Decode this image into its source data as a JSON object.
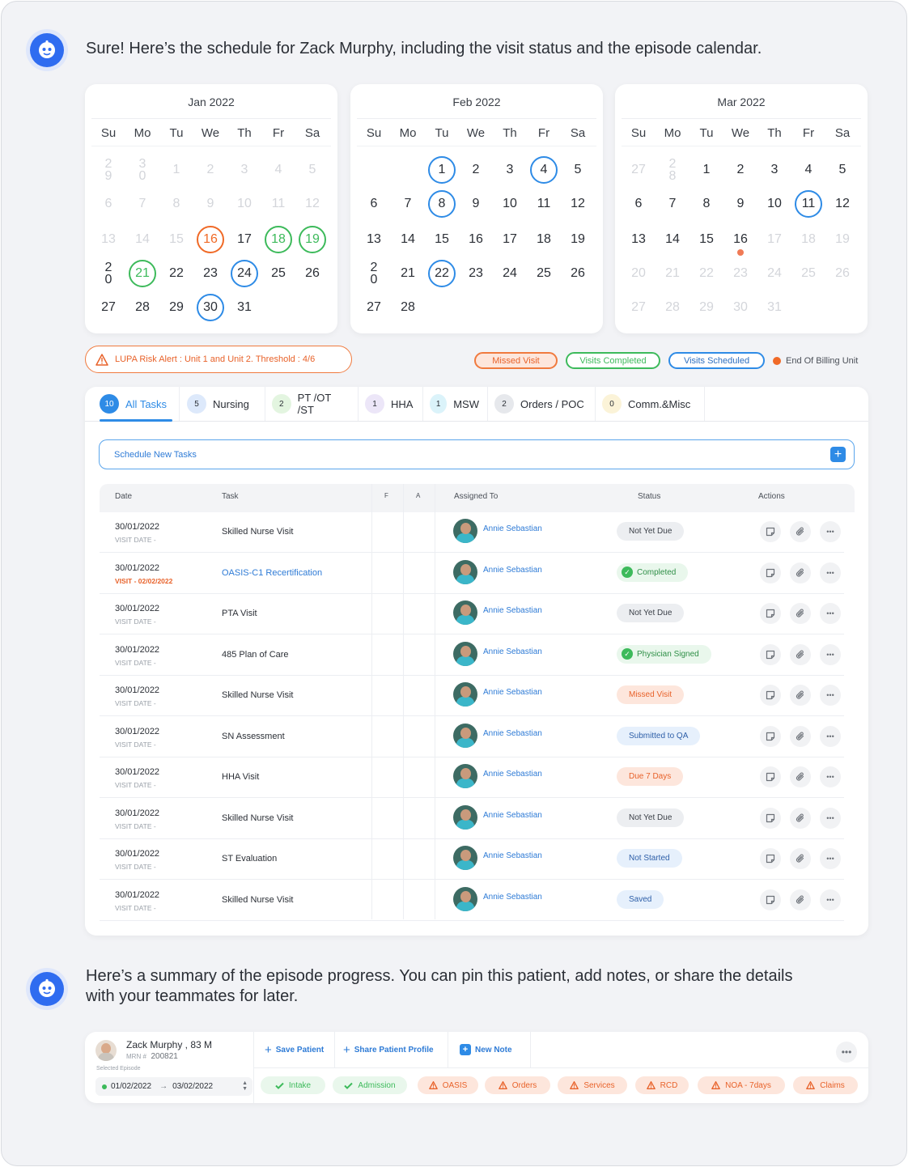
{
  "messages": {
    "first": "Sure! Here’s the schedule for Zack Murphy, including the visit status and the episode calendar.",
    "second_line1": "Here’s a summary of the episode progress. You can pin this patient, add notes, or share the details",
    "second_line2": "with your teammates for later."
  },
  "calendars": [
    {
      "title": "Jan 2022",
      "weekdays": [
        "Su",
        "Mo",
        "Tu",
        "We",
        "Th",
        "Fr",
        "Sa"
      ],
      "rows": [
        [
          "2\n9",
          "3\n0",
          "1",
          "2",
          "3",
          "4",
          "5"
        ],
        [
          "6",
          "7",
          "8",
          "9",
          "10",
          "11",
          "12"
        ],
        [
          "13",
          "14",
          "15",
          "16",
          "17",
          "18",
          "19"
        ],
        [
          "2\n0",
          "21",
          "22",
          "23",
          "24",
          "25",
          "26"
        ],
        [
          "27",
          "28",
          "29",
          "30",
          "31",
          "",
          ""
        ]
      ]
    },
    {
      "title": "Feb 2022",
      "weekdays": [
        "Su",
        "Mo",
        "Tu",
        "We",
        "Th",
        "Fr",
        "Sa"
      ],
      "rows": [
        [
          "",
          "",
          "1",
          "2",
          "3",
          "4",
          "5"
        ],
        [
          "6",
          "7",
          "8",
          "9",
          "10",
          "11",
          "12"
        ],
        [
          "13",
          "14",
          "15",
          "16",
          "17",
          "18",
          "19"
        ],
        [
          "2\n0",
          "21",
          "22",
          "23",
          "24",
          "25",
          "26"
        ],
        [
          "27",
          "28",
          "",
          "",
          "",
          "",
          ""
        ]
      ]
    },
    {
      "title": "Mar 2022",
      "weekdays": [
        "Su",
        "Mo",
        "Tu",
        "We",
        "Th",
        "Fr",
        "Sa"
      ],
      "rows": [
        [
          "27",
          "2\n8",
          "1",
          "2",
          "3",
          "4",
          "5"
        ],
        [
          "6",
          "7",
          "8",
          "9",
          "10",
          "11",
          "12"
        ],
        [
          "13",
          "14",
          "15",
          "16",
          "17",
          "18",
          "19"
        ],
        [
          "20",
          "21",
          "22",
          "23",
          "24",
          "25",
          "26"
        ],
        [
          "27",
          "28",
          "29",
          "30",
          "31",
          "",
          ""
        ]
      ]
    }
  ],
  "alert": {
    "text": "LUPA Risk Alert : Unit 1 and Unit 2. Threshold : 4/6"
  },
  "legend": {
    "missed": "Missed Visit",
    "completed": "Visits Completed",
    "scheduled": "Visits Scheduled",
    "billing": "End Of Billing Unit"
  },
  "tabs": [
    {
      "count": "10",
      "label": "All Tasks"
    },
    {
      "count": "5",
      "label": "Nursing"
    },
    {
      "count": "2",
      "label": "PT /OT /ST"
    },
    {
      "count": "1",
      "label": "HHA"
    },
    {
      "count": "1",
      "label": "MSW"
    },
    {
      "count": "2",
      "label": "Orders / POC"
    },
    {
      "count": "0",
      "label": "Comm.&Misc"
    }
  ],
  "schedule_label": "Schedule New Tasks",
  "table": {
    "headers": {
      "date": "Date",
      "task": "Task",
      "f": "F",
      "a": "A",
      "assigned": "Assigned To",
      "status": "Status",
      "actions": "Actions"
    },
    "rows": [
      {
        "date": "30/01/2022",
        "visit": "VISIT DATE    -",
        "task": "Skilled Nurse Visit",
        "assigned": "Annie Sebastian",
        "status": "Not Yet Due"
      },
      {
        "date": "30/01/2022",
        "visit": "VISIT -  02/02/2022",
        "task": "OASIS-C1 Recertification",
        "assigned": "Annie Sebastian",
        "status": "Completed"
      },
      {
        "date": "30/01/2022",
        "visit": "VISIT DATE    -",
        "task": "PTA Visit",
        "assigned": "Annie Sebastian",
        "status": "Not Yet Due"
      },
      {
        "date": "30/01/2022",
        "visit": "VISIT DATE    -",
        "task": "485 Plan of Care",
        "assigned": "Annie Sebastian",
        "status": "Physician Signed"
      },
      {
        "date": "30/01/2022",
        "visit": "VISIT DATE    -",
        "task": "Skilled Nurse Visit",
        "assigned": "Annie Sebastian",
        "status": "Missed Visit"
      },
      {
        "date": "30/01/2022",
        "visit": "VISIT DATE    -",
        "task": "SN Assessment",
        "assigned": "Annie Sebastian",
        "status": "Submitted to QA"
      },
      {
        "date": "30/01/2022",
        "visit": "VISIT DATE    -",
        "task": "HHA Visit",
        "assigned": "Annie Sebastian",
        "status": "Due 7 Days"
      },
      {
        "date": "30/01/2022",
        "visit": "VISIT DATE    -",
        "task": "Skilled Nurse Visit",
        "assigned": "Annie Sebastian",
        "status": "Not Yet Due"
      },
      {
        "date": "30/01/2022",
        "visit": "VISIT DATE    -",
        "task": "ST Evaluation",
        "assigned": "Annie Sebastian",
        "status": "Not Started"
      },
      {
        "date": "30/01/2022",
        "visit": "VISIT DATE    -",
        "task": "Skilled Nurse Visit",
        "assigned": "Annie Sebastian",
        "status": "Saved"
      }
    ]
  },
  "patient": {
    "name": "Zack Murphy , 83 M",
    "mrn_label": "MRN #",
    "mrn": "200821",
    "episode_label": "Selected Episode",
    "start": "01/02/2022",
    "end": "03/02/2022",
    "actions": {
      "save": "Save Patient",
      "share": "Share Patient Profile",
      "note": "New Note"
    },
    "milestones": [
      "Intake",
      "Admission",
      "OASIS",
      "Orders",
      "Services",
      "RCD",
      "NOA - 7days",
      "Claims"
    ]
  }
}
